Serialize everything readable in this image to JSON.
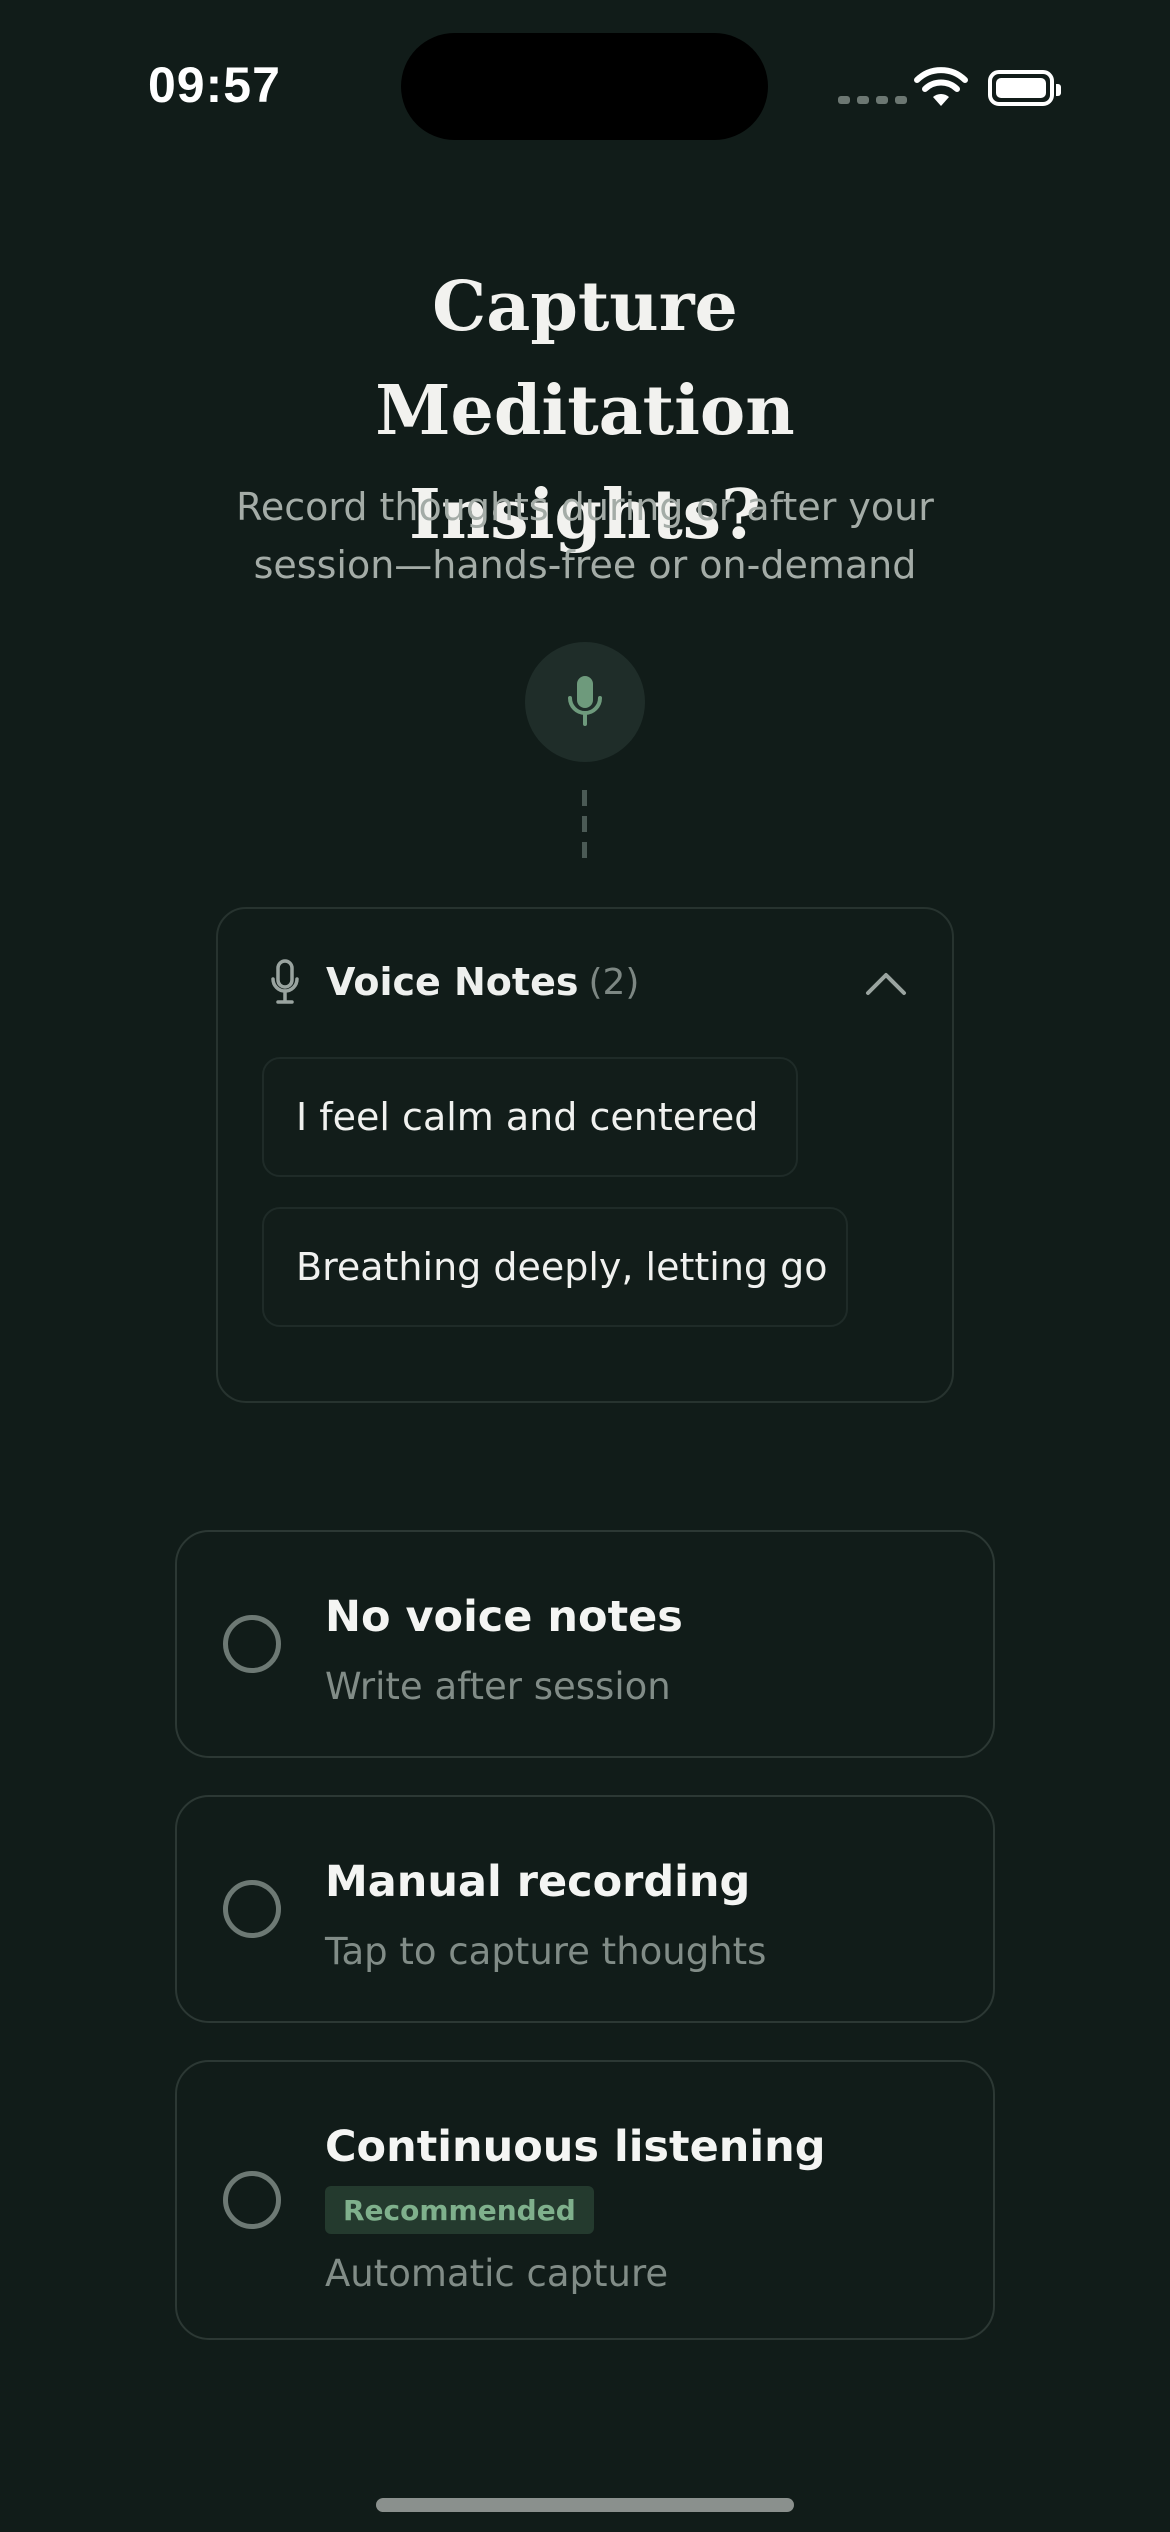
{
  "status_bar": {
    "time": "09:57"
  },
  "header": {
    "title": "Capture Meditation Insights?",
    "subtitle": "Record thoughts during or after your session—hands-free or on-demand"
  },
  "voice_notes": {
    "title": "Voice Notes",
    "count": "(2)",
    "notes": [
      {
        "text": "I feel calm and centered"
      },
      {
        "text": "Breathing deeply, letting go"
      }
    ]
  },
  "options": [
    {
      "title": "No voice notes",
      "subtitle": "Write after session"
    },
    {
      "title": "Manual recording",
      "subtitle": "Tap to capture thoughts"
    },
    {
      "title": "Continuous listening",
      "badge": "Recommended",
      "subtitle": "Automatic capture"
    }
  ],
  "colors": {
    "background": "#111c19",
    "accent_green": "#7fb08c",
    "card_border": "#2c3834",
    "muted_text": "#818c87"
  },
  "icons": [
    "microphone-icon",
    "chevron-up-icon",
    "wifi-icon",
    "battery-icon",
    "cellular-signal-icon"
  ]
}
